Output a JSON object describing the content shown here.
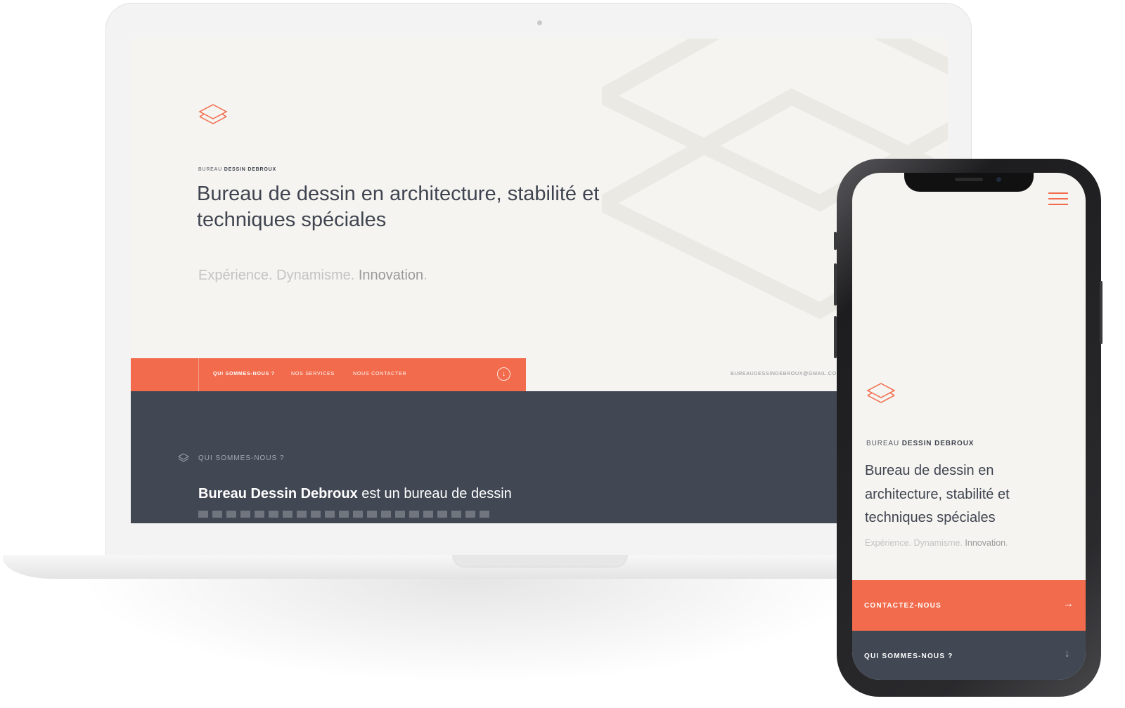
{
  "brand": {
    "eyebrow_prefix": "BUREAU",
    "eyebrow_name": "DESSIN DEBROUX",
    "accent_color": "#f26b4c",
    "dark_color": "#414753",
    "logo_icon": "layers-icon"
  },
  "laptop": {
    "headline": "Bureau de dessin en architecture, stabilité et techniques spéciales",
    "tagline_part1": "Expérience. Dynamisme. ",
    "tagline_part2": "Innovation",
    "tagline_part3": ".",
    "nav": {
      "items": [
        "QUI SOMMES-NOUS ?",
        "NOS SERVICES",
        "NOUS CONTACTER"
      ],
      "scroll_icon": "arrow-down-circle-icon"
    },
    "email": "BUREAUDESSINDEBROUX@GMAIL.COM",
    "section": {
      "label": "QUI SOMMES-NOUS ?",
      "text_bold": "Bureau Dessin Debroux",
      "text_rest": " est un bureau de dessin"
    }
  },
  "phone": {
    "menu_icon": "hamburger-icon",
    "headline": "Bureau de dessin en architecture, stabilité et techniques spéciales",
    "tagline_part1": "Expérience. Dynamisme. ",
    "tagline_part2": "Innovation",
    "tagline_part3": ".",
    "cta_label": "CONTACTEZ-NOUS",
    "cta_icon": "arrow-right-icon",
    "section_label": "QUI SOMMES-NOUS ?",
    "section_icon": "arrow-down-icon"
  }
}
